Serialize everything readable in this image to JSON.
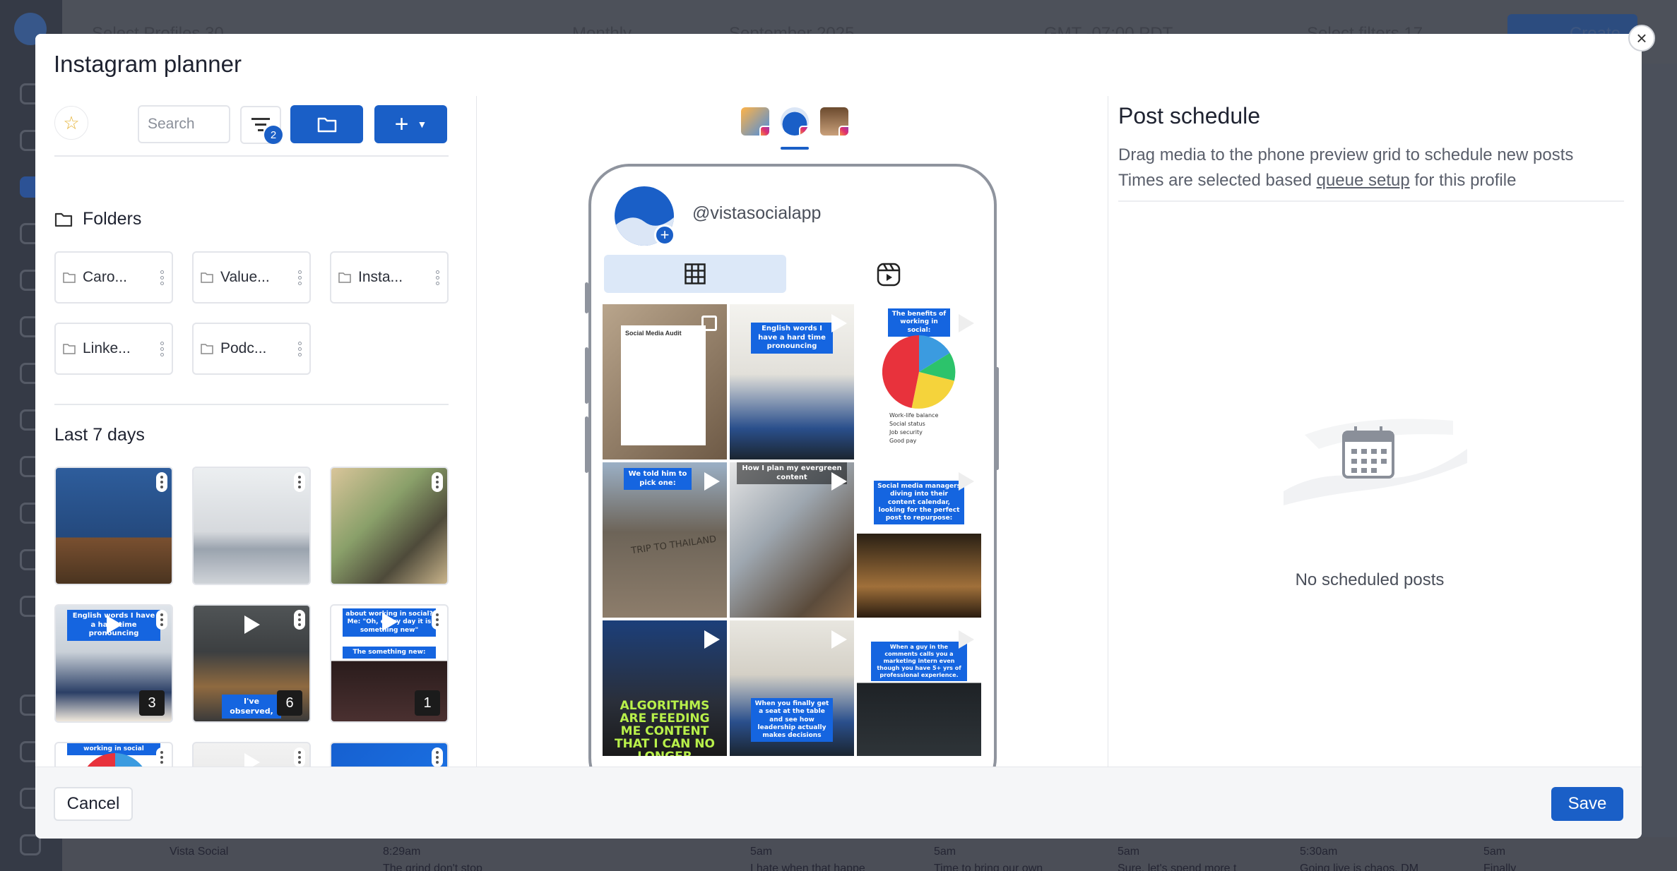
{
  "background": {
    "top_items": [
      "Select Profiles 30",
      "Monthly",
      "September 2025",
      "GMT -07:00 PDT",
      "Select filters 17"
    ],
    "create_label": "Create",
    "bottom_cells": [
      "Vista Social",
      "8:29am",
      "5am",
      "5am",
      "5am",
      "5:30am",
      "5am"
    ],
    "snippets": [
      "The grind don't stop",
      "I hate when that happe",
      "Time to bring our own",
      "Sure, let's spend more t",
      "Going live is chaos, DM",
      "Finally"
    ]
  },
  "modal": {
    "title": "Instagram planner",
    "close_icon": "close-icon"
  },
  "left_panel": {
    "search_placeholder": "Search",
    "filter_count": "2",
    "folders_title": "Folders",
    "folders": [
      {
        "name": "Caro..."
      },
      {
        "name": "Value..."
      },
      {
        "name": "Insta..."
      },
      {
        "name": "Linke..."
      },
      {
        "name": "Podc..."
      }
    ],
    "recent_title": "Last 7 days",
    "media_counts": [
      "3",
      "6",
      "1"
    ],
    "captions": {
      "english_words": "English words I have a hard time pronouncing",
      "observed": "I've observed,",
      "oh_every": "about working in social? Me: \"Oh, every day it is something new\"",
      "something_new": "The something new:",
      "social_label": "working in social"
    }
  },
  "middle_panel": {
    "handle": "@vistasocialapp",
    "tiles": {
      "audit_title": "Social Media Audit",
      "english_words": "English words I have a hard time pronouncing",
      "benefits": "The benefits of working in social:",
      "legend": [
        "Work-life balance",
        "Social status",
        "Job security",
        "Good pay"
      ],
      "pick_one": "We told him to pick one:",
      "evergreen": "How I plan my evergreen content",
      "managers": "Social media managers diving into their content calendar, looking for the perfect post to repurpose:",
      "algorithms": "ALGORITHMS ARE FEEDING ME CONTENT THAT I CAN NO LONGER ESCAPE",
      "leadership": "When you finally get a seat at the table and see how leadership actually makes decisions",
      "intern": "When a guy in the comments calls you a marketing intern even though you have 5+ yrs of professional experience.",
      "trip": "TRIP TO THAILAND"
    }
  },
  "right_panel": {
    "title": "Post schedule",
    "line1": "Drag media to the phone preview grid to schedule new posts",
    "line2_prefix": "Times are selected based ",
    "line2_link": "queue setup",
    "line2_suffix": " for this profile",
    "empty_text": "No scheduled posts"
  },
  "footer": {
    "cancel_label": "Cancel",
    "save_label": "Save"
  },
  "colors": {
    "primary": "#1a5fc7",
    "tab_bg": "#dce8f8",
    "caption_blue": "#1565e0"
  }
}
